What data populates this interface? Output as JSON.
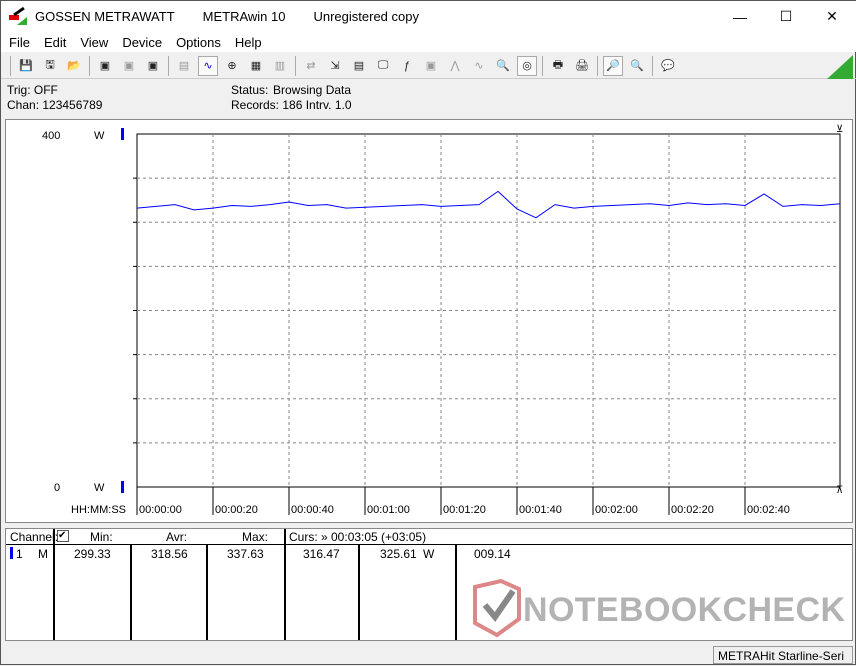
{
  "titlebar": {
    "brand": "GOSSEN METRAWATT",
    "app": "METRAwin 10",
    "license": "Unregistered copy"
  },
  "menu": [
    "File",
    "Edit",
    "View",
    "Device",
    "Options",
    "Help"
  ],
  "info": {
    "trig": "Trig: OFF",
    "chan": "Chan:  123456789",
    "status_label": "Status:",
    "status_value": "Browsing Data",
    "records": "Records: 186  Intrv. 1.0"
  },
  "chart_data": {
    "type": "line",
    "y_top_label": "400",
    "y_bottom_label": "0",
    "y_unit": "W",
    "ylim": [
      0,
      400
    ],
    "x_axis_label": "HH:MM:SS",
    "x_ticks": [
      "00:00:00",
      "00:00:20",
      "00:00:40",
      "00:01:00",
      "00:01:20",
      "00:01:40",
      "00:02:00",
      "00:02:20",
      "00:02:40"
    ],
    "xlim_seconds": [
      0,
      185
    ],
    "grid": true,
    "color": "#0000ff",
    "t": [
      0,
      5,
      10,
      15,
      20,
      25,
      30,
      35,
      40,
      45,
      50,
      55,
      60,
      65,
      70,
      75,
      80,
      85,
      90,
      95,
      100,
      105,
      110,
      115,
      120,
      125,
      130,
      135,
      140,
      145,
      150,
      155,
      160,
      165,
      170,
      175,
      180,
      185
    ],
    "values": [
      316,
      318,
      320,
      314,
      316,
      319,
      318,
      320,
      323,
      319,
      320,
      316,
      317,
      318,
      319,
      320,
      318,
      319,
      320,
      335,
      315,
      305,
      320,
      316,
      318,
      319,
      320,
      321,
      319,
      322,
      320,
      321,
      319,
      332,
      318,
      320,
      319,
      321
    ]
  },
  "table": {
    "channel_header": "Channel:",
    "min_header": "Min:",
    "avr_header": "Avr:",
    "max_header": "Max:",
    "cursor_header": "Curs: » 00:03:05 (+03:05)",
    "row": {
      "num": "1",
      "mode": "M",
      "min": "299.33",
      "avr": "318.56",
      "max": "337.63",
      "cur1": "316.47",
      "cur2": "325.61",
      "unit": "W",
      "diff": "009.14"
    }
  },
  "status_bar": {
    "device": "METRAHit Starline-Seri"
  },
  "watermark": "NOTEBOOKCHECK"
}
